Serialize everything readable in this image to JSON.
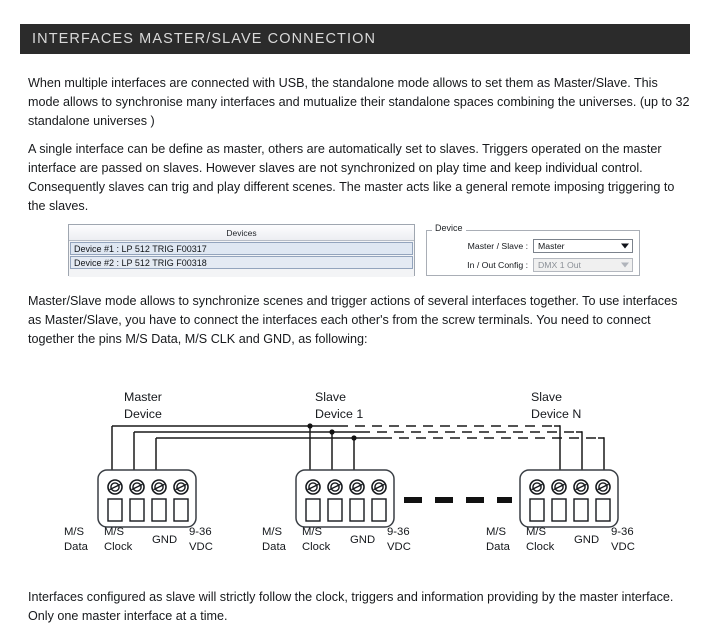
{
  "header": {
    "title": "INTERFACES MASTER/SLAVE CONNECTION",
    "bg_color": "#2b2b2b",
    "text_color": "#d9d9d9"
  },
  "paragraphs": {
    "p1": "When multiple interfaces are connected with USB, the standalone mode allows to set them as Master/Slave.  This mode allows to synchronise many interfaces and mutualize their standalone spaces combining the universes. (up to 32 standalone universes )",
    "p2": "A single interface can be define as master, others are automatically set to slaves. Triggers operated on the master interface are passed on slaves. However slaves are not synchronized on play time and keep individual control. Consequently slaves can trig and play different scenes. The master acts like a general remote imposing triggering to the slaves.",
    "p3": "Master/Slave mode allows to synchronize scenes and trigger actions of several interfaces together. To use interfaces as Master/Slave, you have to connect the interfaces each other's from the screw terminals. You need to connect together the pins M/S Data, M/S CLK and GND, as following:",
    "p4": "Interfaces configured as slave will strictly follow the clock, triggers and information providing by the master interface. Only one master interface at a time."
  },
  "software_panel": {
    "devices_list": {
      "column_header": "Devices",
      "rows": [
        "Device #1 : LP 512 TRIG F00317",
        "Device #2 : LP 512 TRIG F00318"
      ],
      "selection_color": "#dfe7f2"
    },
    "device_settings": {
      "legend": "Device",
      "fields": [
        {
          "label": "Master / Slave :",
          "value": "Master",
          "enabled": true
        },
        {
          "label": "In / Out Config :",
          "value": "DMX 1 Out",
          "enabled": false
        }
      ]
    }
  },
  "diagram": {
    "devices": [
      {
        "line1": "Master",
        "line2": "Device"
      },
      {
        "line1": "Slave",
        "line2": "Device 1"
      },
      {
        "line1": "Slave",
        "line2": "Device N"
      }
    ],
    "pin_labels": [
      {
        "line1": "M/S",
        "line2": "Data"
      },
      {
        "line1": "M/S",
        "line2": "Clock"
      },
      {
        "line1": "GND",
        "line2": ""
      },
      {
        "line1": "9-36",
        "line2": "VDC"
      }
    ],
    "line_color": "#1a1a1a",
    "terminal_count": 4
  }
}
